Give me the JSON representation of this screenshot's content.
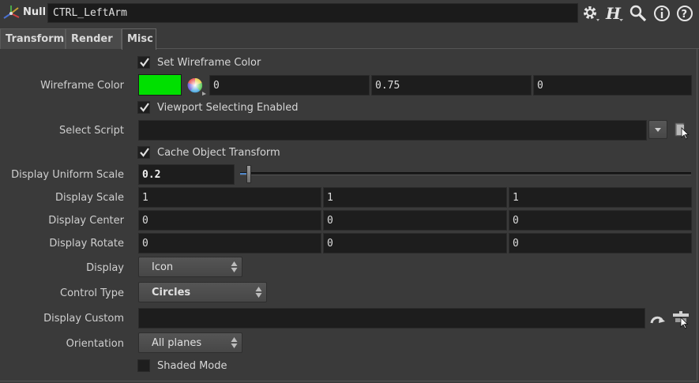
{
  "header": {
    "node_type": "Null",
    "node_name": "CTRL_LeftArm",
    "icons": [
      "null-axis-icon",
      "gear-icon",
      "houdini-help-icon",
      "search-icon",
      "info-icon",
      "help-icon"
    ]
  },
  "tabs": [
    {
      "label": "Transform",
      "active": false
    },
    {
      "label": "Render",
      "active": false
    },
    {
      "label": "Misc",
      "active": true
    }
  ],
  "params": {
    "set_wireframe_color": {
      "label": "Set Wireframe Color",
      "checked": true
    },
    "wireframe_color": {
      "label": "Wireframe Color",
      "swatch": "#00e000",
      "r": "0",
      "g": "0.75",
      "b": "0"
    },
    "viewport_selecting": {
      "label": "Viewport Selecting Enabled",
      "checked": true
    },
    "select_script": {
      "label": "Select Script",
      "value": ""
    },
    "cache_object_transform": {
      "label": "Cache Object Transform",
      "checked": true
    },
    "display_uniform_scale": {
      "label": "Display Uniform Scale",
      "value": "0.2",
      "fraction": 0.02
    },
    "display_scale": {
      "label": "Display Scale",
      "x": "1",
      "y": "1",
      "z": "1"
    },
    "display_center": {
      "label": "Display Center",
      "x": "0",
      "y": "0",
      "z": "0"
    },
    "display_rotate": {
      "label": "Display Rotate",
      "x": "0",
      "y": "0",
      "z": "0"
    },
    "display": {
      "label": "Display",
      "value": "Icon"
    },
    "control_type": {
      "label": "Control Type",
      "value": "Circles"
    },
    "display_custom": {
      "label": "Display Custom",
      "value": ""
    },
    "orientation": {
      "label": "Orientation",
      "value": "All planes"
    },
    "shaded_mode": {
      "label": "Shaded Mode",
      "checked": false
    }
  },
  "colors": {
    "accent": "#4f86c8",
    "background": "#3a3a3a",
    "field": "#1d1d1d"
  }
}
